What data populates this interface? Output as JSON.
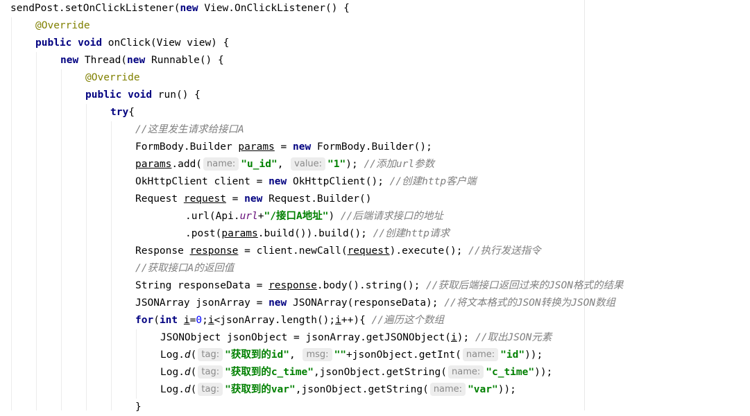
{
  "lines": [
    {
      "indent": 0,
      "tokens": [
        {
          "t": "sendPost.setOnClickListener("
        },
        {
          "t": "new",
          "c": "kw"
        },
        {
          "t": " View.OnClickListener() {"
        }
      ]
    },
    {
      "indent": 1,
      "tokens": [
        {
          "t": "@Override",
          "c": "ann"
        }
      ]
    },
    {
      "indent": 1,
      "tokens": [
        {
          "t": "public",
          "c": "kw"
        },
        {
          "t": " "
        },
        {
          "t": "void",
          "c": "kw"
        },
        {
          "t": " onClick(View view) {"
        }
      ]
    },
    {
      "indent": 2,
      "tokens": [
        {
          "t": "new",
          "c": "kw"
        },
        {
          "t": " Thread("
        },
        {
          "t": "new",
          "c": "kw"
        },
        {
          "t": " Runnable() {"
        }
      ]
    },
    {
      "indent": 3,
      "tokens": [
        {
          "t": "@Override",
          "c": "ann"
        }
      ]
    },
    {
      "indent": 3,
      "tokens": [
        {
          "t": "public",
          "c": "kw"
        },
        {
          "t": " "
        },
        {
          "t": "void",
          "c": "kw"
        },
        {
          "t": " run() {"
        }
      ]
    },
    {
      "indent": 4,
      "tokens": [
        {
          "t": "try",
          "c": "kw"
        },
        {
          "t": "{"
        }
      ]
    },
    {
      "indent": 5,
      "tokens": [
        {
          "t": "//这里发生请求给接口A",
          "c": "cm"
        }
      ]
    },
    {
      "indent": 5,
      "tokens": [
        {
          "t": "FormBody.Builder "
        },
        {
          "t": "params",
          "c": "ul"
        },
        {
          "t": " = "
        },
        {
          "t": "new",
          "c": "kw"
        },
        {
          "t": " FormBody.Builder();"
        }
      ]
    },
    {
      "indent": 5,
      "tokens": [
        {
          "t": "params",
          "c": "ul"
        },
        {
          "t": ".add("
        },
        {
          "t": "name:",
          "c": "hint"
        },
        {
          "t": "\"u_id\"",
          "c": "str"
        },
        {
          "t": ", "
        },
        {
          "t": "value:",
          "c": "hint"
        },
        {
          "t": "\"1\"",
          "c": "str"
        },
        {
          "t": "); "
        },
        {
          "t": "//添加url参数",
          "c": "cm"
        }
      ]
    },
    {
      "indent": 5,
      "tokens": [
        {
          "t": "OkHttpClient client = "
        },
        {
          "t": "new",
          "c": "kw"
        },
        {
          "t": " OkHttpClient(); "
        },
        {
          "t": "//创建http客户端",
          "c": "cm"
        }
      ]
    },
    {
      "indent": 5,
      "tokens": [
        {
          "t": "Request "
        },
        {
          "t": "request",
          "c": "ul"
        },
        {
          "t": " = "
        },
        {
          "t": "new",
          "c": "kw"
        },
        {
          "t": " Request.Builder()"
        }
      ]
    },
    {
      "indent": 7,
      "tokens": [
        {
          "t": ".url(Api."
        },
        {
          "t": "url",
          "c": "fld"
        },
        {
          "t": "+"
        },
        {
          "t": "\"/接口A地址\"",
          "c": "str"
        },
        {
          "t": ") "
        },
        {
          "t": "//后端请求接口的地址",
          "c": "cm"
        }
      ]
    },
    {
      "indent": 7,
      "tokens": [
        {
          "t": ".post("
        },
        {
          "t": "params",
          "c": "ul"
        },
        {
          "t": ".build()).build(); "
        },
        {
          "t": "//创建http请求",
          "c": "cm"
        }
      ]
    },
    {
      "indent": 5,
      "tokens": [
        {
          "t": "Response "
        },
        {
          "t": "response",
          "c": "ul"
        },
        {
          "t": " = client.newCall("
        },
        {
          "t": "request",
          "c": "ul"
        },
        {
          "t": ").execute(); "
        },
        {
          "t": "//执行发送指令",
          "c": "cm"
        }
      ]
    },
    {
      "indent": 5,
      "tokens": [
        {
          "t": "//获取接口A的返回值",
          "c": "cm"
        }
      ]
    },
    {
      "indent": 5,
      "tokens": [
        {
          "t": "String responseData = "
        },
        {
          "t": "response",
          "c": "ul"
        },
        {
          "t": ".body().string(); "
        },
        {
          "t": "//获取后端接口返回过来的JSON格式的结果",
          "c": "cm"
        }
      ]
    },
    {
      "indent": 5,
      "tokens": [
        {
          "t": "JSONArray jsonArray = "
        },
        {
          "t": "new",
          "c": "kw"
        },
        {
          "t": " JSONArray(responseData); "
        },
        {
          "t": "//将文本格式的JSON转换为JSON数组",
          "c": "cm"
        }
      ]
    },
    {
      "indent": 5,
      "tokens": [
        {
          "t": "for",
          "c": "kw"
        },
        {
          "t": "("
        },
        {
          "t": "int",
          "c": "kw"
        },
        {
          "t": " "
        },
        {
          "t": "i",
          "c": "ul"
        },
        {
          "t": "="
        },
        {
          "t": "0",
          "c": "num"
        },
        {
          "t": ";"
        },
        {
          "t": "i",
          "c": "ul"
        },
        {
          "t": "<jsonArray.length();"
        },
        {
          "t": "i",
          "c": "ul"
        },
        {
          "t": "++){ "
        },
        {
          "t": "//遍历这个数组",
          "c": "cm"
        }
      ]
    },
    {
      "indent": 6,
      "tokens": [
        {
          "t": "JSONObject jsonObject = jsonArray.getJSONObject("
        },
        {
          "t": "i",
          "c": "ul"
        },
        {
          "t": "); "
        },
        {
          "t": "//取出JSON元素",
          "c": "cm"
        }
      ]
    },
    {
      "indent": 6,
      "tokens": [
        {
          "t": "Log."
        },
        {
          "t": "d",
          "c": "it"
        },
        {
          "t": "("
        },
        {
          "t": "tag:",
          "c": "hint"
        },
        {
          "t": "\"获取到的id\"",
          "c": "str"
        },
        {
          "t": ", "
        },
        {
          "t": "msg:",
          "c": "hint"
        },
        {
          "t": "\"\"",
          "c": "str"
        },
        {
          "t": "+jsonObject.getInt("
        },
        {
          "t": "name:",
          "c": "hint"
        },
        {
          "t": "\"id\"",
          "c": "str"
        },
        {
          "t": "));"
        }
      ]
    },
    {
      "indent": 6,
      "tokens": [
        {
          "t": "Log."
        },
        {
          "t": "d",
          "c": "it"
        },
        {
          "t": "("
        },
        {
          "t": "tag:",
          "c": "hint"
        },
        {
          "t": "\"获取到的c_time\"",
          "c": "str"
        },
        {
          "t": ",jsonObject.getString("
        },
        {
          "t": "name:",
          "c": "hint"
        },
        {
          "t": "\"c_time\"",
          "c": "str"
        },
        {
          "t": "));"
        }
      ]
    },
    {
      "indent": 6,
      "tokens": [
        {
          "t": "Log."
        },
        {
          "t": "d",
          "c": "it"
        },
        {
          "t": "("
        },
        {
          "t": "tag:",
          "c": "hint"
        },
        {
          "t": "\"获取到的var\"",
          "c": "str"
        },
        {
          "t": ",jsonObject.getString("
        },
        {
          "t": "name:",
          "c": "hint"
        },
        {
          "t": "\"var\"",
          "c": "str"
        },
        {
          "t": "));"
        }
      ]
    },
    {
      "indent": 5,
      "tokens": [
        {
          "t": "}"
        }
      ]
    }
  ]
}
